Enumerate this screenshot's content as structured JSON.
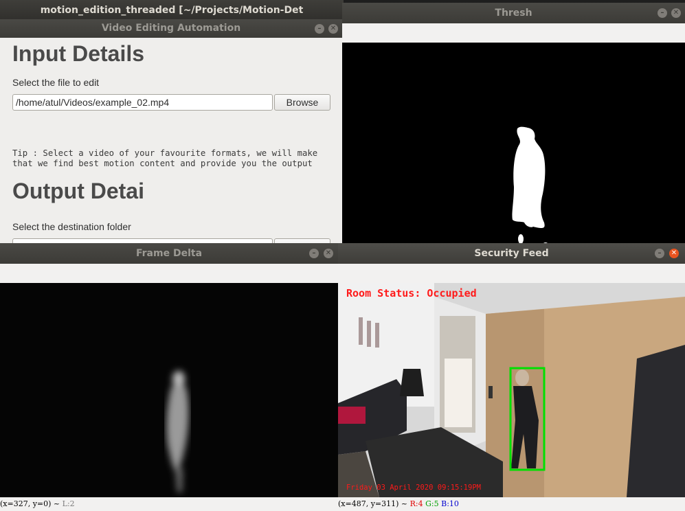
{
  "editor": {
    "title": "motion_edition_threaded [~/Projects/Motion-Det"
  },
  "app": {
    "title": "Video Editing Automation",
    "input_heading": "Input Details",
    "file_label": "Select the file to edit",
    "file_value": "/home/atul/Videos/example_02.mp4",
    "browse_label": "Browse",
    "tip_line1": "Tip : Select a video of your favourite formats, we will make",
    "tip_line2": "that we find best motion content and provide you the output",
    "output_heading": "Output Detai",
    "dest_label": "Select the destination folder"
  },
  "thresh": {
    "title": "Thresh"
  },
  "frame_delta": {
    "title": "Frame Delta",
    "status_pos": "(x=327, y=0) ~",
    "status_level": "L:2"
  },
  "security": {
    "title": "Security Feed",
    "room_status": "Room Status: Occupied",
    "timestamp": "Friday 03 April 2020 09:15:19PM",
    "status_pos": "(x=487, y=311) ~",
    "status_r": "R:4",
    "status_g": "G:5",
    "status_b": "B:10"
  },
  "colors": {
    "overlay_text": "#ff1a1a",
    "detection_box": "#00e000",
    "accent_close": "#e95420"
  }
}
